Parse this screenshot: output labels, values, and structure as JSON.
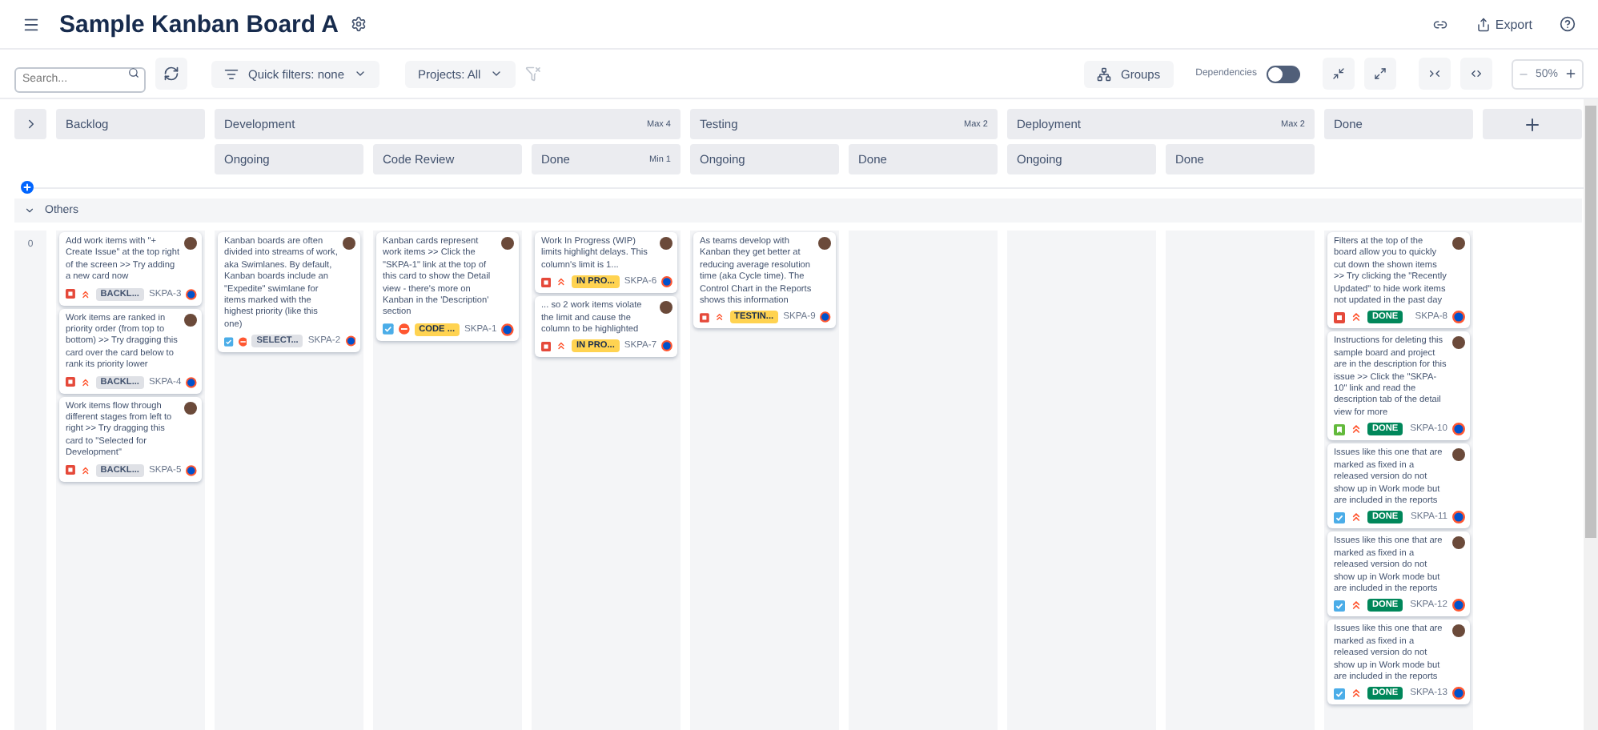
{
  "header": {
    "title": "Sample Kanban Board A",
    "export_label": "Export"
  },
  "toolbar": {
    "search_placeholder": "Search...",
    "quick_filters": "Quick filters: none",
    "projects": "Projects: All",
    "groups": "Groups",
    "dependencies": {
      "label": "Dependencies",
      "on": false
    },
    "zoom": "50%"
  },
  "columns": [
    {
      "name": "Backlog"
    },
    {
      "name": "Development",
      "limit": "Max 4",
      "subcolumns": [
        {
          "name": "Ongoing"
        },
        {
          "name": "Code Review"
        },
        {
          "name": "Done",
          "limit": "Min 1"
        }
      ]
    },
    {
      "name": "Testing",
      "limit": "Max 2",
      "subcolumns": [
        {
          "name": "Ongoing"
        },
        {
          "name": "Done"
        }
      ]
    },
    {
      "name": "Deployment",
      "limit": "Max 2",
      "subcolumns": [
        {
          "name": "Ongoing"
        },
        {
          "name": "Done"
        }
      ]
    },
    {
      "name": "Done"
    }
  ],
  "lanes": [
    {
      "name": "Others",
      "expanded": true,
      "row_label": "0",
      "cells": [
        [
          {
            "text": "Add work items with \"+ Create Issue\" at the top right of the screen >> Try adding a new card now",
            "type": {
              "kind": "bug"
            },
            "priority": {
              "kind": "highest"
            },
            "status": {
              "label": "BACKL...",
              "kind": "todo"
            },
            "key": "SKPA-3"
          },
          {
            "text": "Work items are ranked in priority order (from top to bottom) >> Try dragging this card over the card below to rank its priority lower",
            "type": {
              "kind": "bug"
            },
            "priority": {
              "kind": "highest"
            },
            "status": {
              "label": "BACKL...",
              "kind": "todo"
            },
            "key": "SKPA-4"
          },
          {
            "text": "Work items flow through different stages from left to right >> Try dragging this card to \"Selected for Development\"",
            "type": {
              "kind": "bug"
            },
            "priority": {
              "kind": "highest"
            },
            "status": {
              "label": "BACKL...",
              "kind": "todo"
            },
            "key": "SKPA-5"
          }
        ],
        [
          {
            "text": "Kanban boards are often divided into streams of work, aka Swimlanes. By default, Kanban boards include an \"Expedite\" swimlane for items marked with the highest priority (like this one)",
            "type": {
              "kind": "task"
            },
            "priority": {
              "kind": "blocker"
            },
            "status": {
              "label": "SELECT...",
              "kind": "todo"
            },
            "key": "SKPA-2"
          }
        ],
        [
          {
            "text": "Kanban cards represent work items >> Click the \"SKPA-1\" link at the top of this card to show the Detail view - there's more on Kanban in the 'Description' section",
            "type": {
              "kind": "task"
            },
            "priority": {
              "kind": "blocker"
            },
            "status": {
              "label": "CODE ...",
              "kind": "inprogress"
            },
            "key": "SKPA-1"
          }
        ],
        [
          {
            "text": "Work In Progress (WIP) limits highlight delays. This column's limit is 1...",
            "type": {
              "kind": "bug"
            },
            "priority": {
              "kind": "highest"
            },
            "status": {
              "label": "IN PRO...",
              "kind": "inprogress"
            },
            "key": "SKPA-6"
          },
          {
            "text": "... so 2 work items violate the limit and cause the column to be highlighted",
            "type": {
              "kind": "bug"
            },
            "priority": {
              "kind": "highest"
            },
            "status": {
              "label": "IN PRO...",
              "kind": "inprogress"
            },
            "key": "SKPA-7"
          }
        ],
        [
          {
            "text": "As teams develop with Kanban they get better at reducing average resolution time (aka Cycle time). The Control Chart in the Reports shows this information",
            "type": {
              "kind": "bug"
            },
            "priority": {
              "kind": "highest"
            },
            "status": {
              "label": "TESTIN...",
              "kind": "inprogress"
            },
            "key": "SKPA-9"
          }
        ],
        [],
        [],
        [],
        [
          {
            "text": "Filters at the top of the board allow you to quickly cut down the shown items >> Try clicking the \"Recently Updated\" to hide work items not updated in the past day",
            "type": {
              "kind": "bug"
            },
            "priority": {
              "kind": "highest"
            },
            "status": {
              "label": "DONE",
              "kind": "done"
            },
            "key": "SKPA-8"
          },
          {
            "text": "Instructions for deleting this sample board and project are in the description for this issue >> Click the \"SKPA-10\" link and read the description tab of the detail view for more",
            "type": {
              "kind": "story"
            },
            "priority": {
              "kind": "highest"
            },
            "status": {
              "label": "DONE",
              "kind": "done"
            },
            "key": "SKPA-10"
          },
          {
            "text": "Issues like this one that are marked as fixed in a released version do not show up in Work mode but are included in the reports",
            "type": {
              "kind": "task"
            },
            "priority": {
              "kind": "highest"
            },
            "status": {
              "label": "DONE",
              "kind": "done"
            },
            "key": "SKPA-11"
          },
          {
            "text": "Issues like this one that are marked as fixed in a released version do not show up in Work mode but are included in the reports",
            "type": {
              "kind": "task"
            },
            "priority": {
              "kind": "highest"
            },
            "status": {
              "label": "DONE",
              "kind": "done"
            },
            "key": "SKPA-12"
          },
          {
            "text": "Issues like this one that are marked as fixed in a released version do not show up in Work mode but are included in the reports",
            "type": {
              "kind": "task"
            },
            "priority": {
              "kind": "highest"
            },
            "status": {
              "label": "DONE",
              "kind": "done"
            },
            "key": "SKPA-13"
          }
        ]
      ]
    }
  ]
}
